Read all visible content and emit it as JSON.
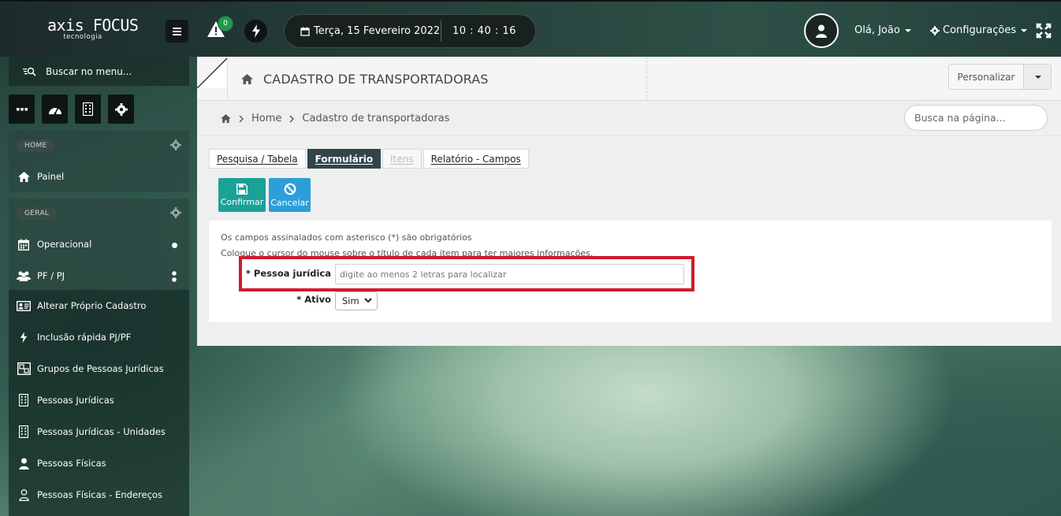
{
  "header": {
    "logo_brand": "axis FOCUS",
    "logo_sub": "tecnologia",
    "alert_count": "0",
    "date": "Terça, 15 Fevereiro 2022",
    "time": "10 : 40 : 16",
    "user_greeting": "Olá, João",
    "settings_label": "Configurações"
  },
  "sidebar": {
    "search_label": "Buscar no menu...",
    "home_section": "HOME",
    "home_items": [
      {
        "label": "Painel",
        "icon": "home-icon"
      }
    ],
    "general_section": "GERAL",
    "general_items": [
      {
        "label": "Operacional",
        "icon": "calendar-icon"
      },
      {
        "label": "PF / PJ",
        "icon": "users-icon"
      }
    ],
    "sub_items": [
      {
        "label": "Alterar Próprio Cadastro",
        "icon": "id-card-icon"
      },
      {
        "label": "Inclusão rápida PJ/PF",
        "icon": "bolt-icon"
      },
      {
        "label": "Grupos de Pessoas Jurídicas",
        "icon": "group-icon"
      },
      {
        "label": "Pessoas Jurídicas",
        "icon": "building-icon"
      },
      {
        "label": "Pessoas Jurídicas - Unidades",
        "icon": "building-units-icon"
      },
      {
        "label": "Pessoas Físicas",
        "icon": "user-icon"
      },
      {
        "label": "Pessoas Físicas - Endereços",
        "icon": "user-outline-icon"
      }
    ]
  },
  "page": {
    "title": "CADASTRO DE TRANSPORTADORAS",
    "personalize_label": "Personalizar",
    "breadcrumb": [
      "Home",
      "Cadastro de transportadoras"
    ],
    "search_placeholder": "Busca na página...",
    "tabs": [
      {
        "label": "Pesquisa / Tabela",
        "state": "normal"
      },
      {
        "label": "Formulário",
        "state": "active"
      },
      {
        "label": "Itens",
        "state": "disabled"
      },
      {
        "label": "Relatório - Campos",
        "state": "normal"
      }
    ],
    "actions": {
      "confirm": "Confirmar",
      "cancel": "Cancelar"
    },
    "info_required": "Os campos assinalados com asterisco (*) são obrigatórios",
    "info_hover": "Coloque o cursor do mouse sobre o título de cada item para ter maiores informações.",
    "fields": {
      "pessoa_label": "* Pessoa jurídica",
      "pessoa_placeholder": "digite ao menos 2 letras para localizar",
      "ativo_label": "* Ativo",
      "ativo_value": "Sim"
    }
  },
  "colors": {
    "confirm": "#1aa296",
    "cancel": "#2c9ed9",
    "active_tab": "#33454a",
    "highlight": "#d11a2a",
    "badge": "#1f9a4a"
  }
}
